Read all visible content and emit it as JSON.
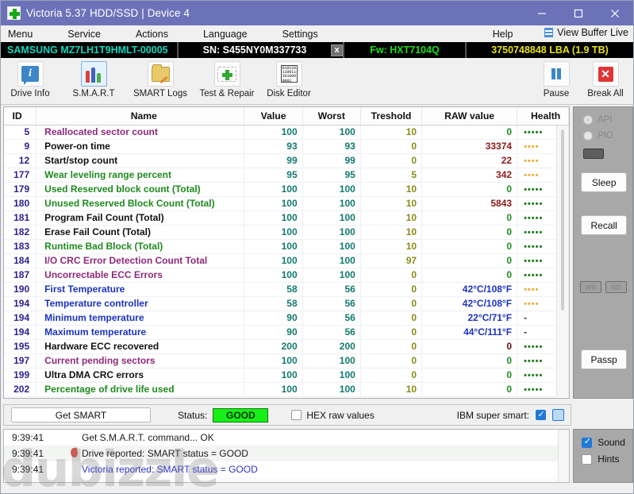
{
  "window": {
    "title": "Victoria 5.37 HDD/SSD | Device 4",
    "logo_icon": "green-cross-icon",
    "minimize_icon": "minimize-icon",
    "maximize_icon": "maximize-icon",
    "close_icon": "close-icon",
    "titlebar_color": "#6b72b8"
  },
  "menubar": {
    "items": [
      "Menu",
      "Service",
      "Actions",
      "Language",
      "Settings",
      "Help"
    ],
    "view_buffer_label": "View Buffer Live",
    "view_buffer_icon": "buffer-lines-icon"
  },
  "device": {
    "model": "SAMSUNG MZ7LH1T9HMLT-00005",
    "serial": "SN: S455NY0M337733",
    "close_btn": "x",
    "firmware": "Fw: HXT7104Q",
    "capacity": "3750748848 LBA (1.9 TB)",
    "model_color": "#0fd7bd",
    "fw_color": "#19e019",
    "lba_color": "#e8e116"
  },
  "toolbar": {
    "buttons": [
      {
        "label": "Drive Info",
        "icon": "info-bubble-icon",
        "selected": false
      },
      {
        "label": "S.M.A.R.T",
        "icon": "test-tubes-icon",
        "selected": true
      },
      {
        "label": "SMART Logs",
        "icon": "folder-edit-icon",
        "selected": false
      },
      {
        "label": "Test & Repair",
        "icon": "first-aid-icon",
        "selected": false
      },
      {
        "label": "Disk Editor",
        "icon": "binary-page-icon",
        "selected": false
      }
    ],
    "right_buttons": [
      {
        "label": "Pause",
        "icon": "pause-icon"
      },
      {
        "label": "Break All",
        "icon": "red-x-icon"
      }
    ]
  },
  "table": {
    "columns": [
      "ID",
      "Name",
      "Value",
      "Worst",
      "Treshold",
      "RAW value",
      "Health"
    ],
    "rows": [
      {
        "id": "5",
        "name": "Reallocated sector count",
        "name_color": "purple",
        "value": "100",
        "worst": "100",
        "treshold": "10",
        "raw": "0",
        "raw_style": "zero",
        "health": "•••••",
        "health_color": "green"
      },
      {
        "id": "9",
        "name": "Power-on time",
        "name_color": "black",
        "value": "93",
        "worst": "93",
        "treshold": "0",
        "raw": "33374",
        "raw_style": "num",
        "health": "••••",
        "health_color": "orange"
      },
      {
        "id": "12",
        "name": "Start/stop count",
        "name_color": "black",
        "value": "99",
        "worst": "99",
        "treshold": "0",
        "raw": "22",
        "raw_style": "num",
        "health": "••••",
        "health_color": "orange"
      },
      {
        "id": "177",
        "name": "Wear leveling range percent",
        "name_color": "green",
        "value": "95",
        "worst": "95",
        "treshold": "5",
        "raw": "342",
        "raw_style": "num",
        "health": "••••",
        "health_color": "orange"
      },
      {
        "id": "179",
        "name": "Used Reserved block count (Total)",
        "name_color": "green",
        "value": "100",
        "worst": "100",
        "treshold": "10",
        "raw": "0",
        "raw_style": "zero",
        "health": "•••••",
        "health_color": "green"
      },
      {
        "id": "180",
        "name": "Unused Reserved Block Count (Total)",
        "name_color": "green",
        "value": "100",
        "worst": "100",
        "treshold": "10",
        "raw": "5843",
        "raw_style": "num",
        "health": "•••••",
        "health_color": "green"
      },
      {
        "id": "181",
        "name": "Program Fail Count (Total)",
        "name_color": "black",
        "value": "100",
        "worst": "100",
        "treshold": "10",
        "raw": "0",
        "raw_style": "zero",
        "health": "•••••",
        "health_color": "green"
      },
      {
        "id": "182",
        "name": "Erase Fail Count (Total)",
        "name_color": "black",
        "value": "100",
        "worst": "100",
        "treshold": "10",
        "raw": "0",
        "raw_style": "zero",
        "health": "•••••",
        "health_color": "green"
      },
      {
        "id": "183",
        "name": "Runtime Bad Block (Total)",
        "name_color": "green",
        "value": "100",
        "worst": "100",
        "treshold": "10",
        "raw": "0",
        "raw_style": "zero",
        "health": "•••••",
        "health_color": "green"
      },
      {
        "id": "184",
        "name": "I/O CRC Error Detection Count Total",
        "name_color": "purple",
        "value": "100",
        "worst": "100",
        "treshold": "97",
        "raw": "0",
        "raw_style": "zero",
        "health": "•••••",
        "health_color": "green"
      },
      {
        "id": "187",
        "name": "Uncorrectable ECC Errors",
        "name_color": "purple",
        "value": "100",
        "worst": "100",
        "treshold": "0",
        "raw": "0",
        "raw_style": "zero",
        "health": "•••••",
        "health_color": "green"
      },
      {
        "id": "190",
        "name": "First Temperature",
        "name_color": "blue",
        "value": "58",
        "worst": "56",
        "treshold": "0",
        "raw": "42°C/108°F",
        "raw_style": "temp",
        "health": "••••",
        "health_color": "orange"
      },
      {
        "id": "194",
        "name": "Temperature controller",
        "name_color": "blue",
        "value": "58",
        "worst": "56",
        "treshold": "0",
        "raw": "42°C/108°F",
        "raw_style": "temp",
        "health": "••••",
        "health_color": "orange"
      },
      {
        "id": "194",
        "name": "Minimum temperature",
        "name_color": "blue",
        "value": "90",
        "worst": "56",
        "treshold": "0",
        "raw": "22°C/71°F",
        "raw_style": "temp",
        "health": "-",
        "health_color": "dash"
      },
      {
        "id": "194",
        "name": "Maximum temperature",
        "name_color": "blue",
        "value": "90",
        "worst": "56",
        "treshold": "0",
        "raw": "44°C/111°F",
        "raw_style": "temp",
        "health": "-",
        "health_color": "dash"
      },
      {
        "id": "195",
        "name": "Hardware ECC recovered",
        "name_color": "black",
        "value": "200",
        "worst": "200",
        "treshold": "0",
        "raw": "0",
        "raw_style": "dark",
        "health": "•••••",
        "health_color": "green"
      },
      {
        "id": "197",
        "name": "Current pending sectors",
        "name_color": "purple",
        "value": "100",
        "worst": "100",
        "treshold": "0",
        "raw": "0",
        "raw_style": "zero",
        "health": "•••••",
        "health_color": "green"
      },
      {
        "id": "199",
        "name": "Ultra DMA CRC errors",
        "name_color": "black",
        "value": "100",
        "worst": "100",
        "treshold": "0",
        "raw": "0",
        "raw_style": "zero",
        "health": "•••••",
        "health_color": "green"
      },
      {
        "id": "202",
        "name": "Percentage of drive life used",
        "name_color": "green",
        "value": "100",
        "worst": "100",
        "treshold": "10",
        "raw": "0",
        "raw_style": "zero",
        "health": "•••••",
        "health_color": "green"
      }
    ]
  },
  "sidepanel": {
    "radios": [
      {
        "label": "API",
        "selected": true
      },
      {
        "label": "PIO",
        "selected": false
      }
    ],
    "buttons": [
      {
        "label": "Sleep"
      },
      {
        "label": "Recall"
      },
      {
        "label": "Passp"
      }
    ],
    "small_buttons": [
      {
        "label": "WR"
      },
      {
        "label": "RD"
      }
    ]
  },
  "statusbar": {
    "get_smart_label": "Get SMART",
    "status_label": "Status:",
    "status_value": "GOOD",
    "status_value_bg": "#17ef17",
    "hex_raw_label": "HEX raw values",
    "hex_raw_checked": false,
    "ibm_label": "IBM super smart:",
    "ibm_checked": true
  },
  "log": {
    "lines": [
      {
        "time": "9:39:41",
        "text": "Get S.M.A.R.T. command... OK",
        "color": "black",
        "icon": ""
      },
      {
        "time": "9:39:41",
        "text": "Drive reported: SMART status = GOOD",
        "color": "black",
        "icon": "flame-icon"
      },
      {
        "time": "9:39:41",
        "text": "Victoria reported: SMART status = GOOD",
        "color": "blue",
        "icon": ""
      }
    ]
  },
  "options": {
    "sound_label": "Sound",
    "sound_checked": true,
    "hints_label": "Hints",
    "hints_checked": false
  },
  "watermark": {
    "text": "dubizzle"
  }
}
